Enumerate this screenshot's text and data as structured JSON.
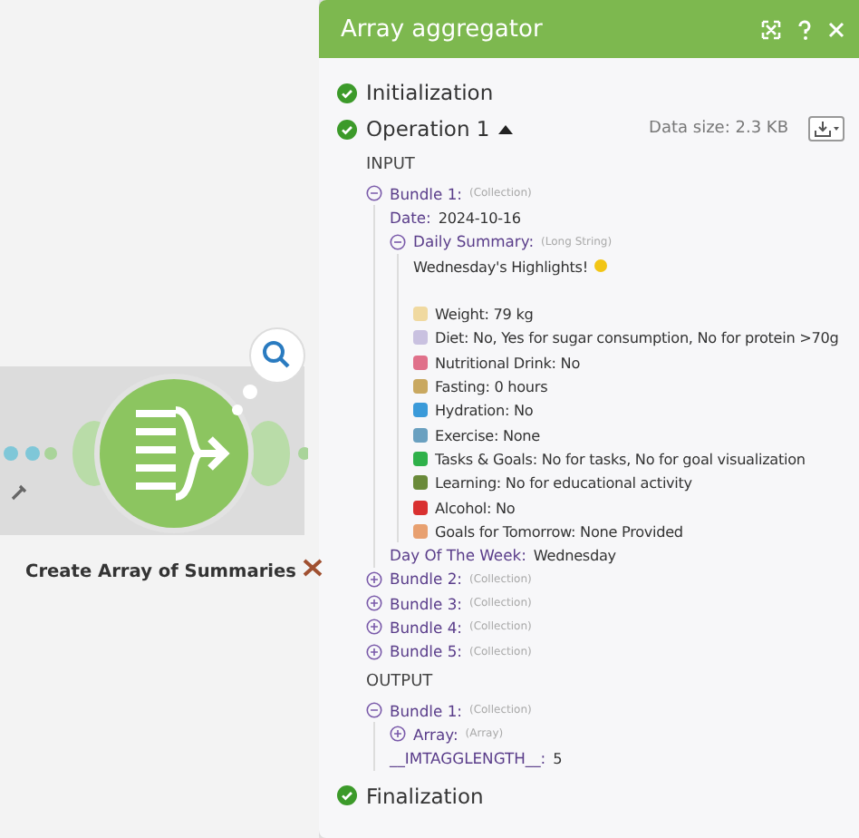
{
  "canvas": {
    "module_label": "Create Array of Summaries"
  },
  "panel": {
    "title": "Array aggregator"
  },
  "initialization": {
    "label": "Initialization"
  },
  "operation": {
    "label": "Operation 1",
    "expanded": true,
    "data_size": "Data size: 2.3 KB",
    "input_label": "INPUT",
    "input": [
      {
        "kind": "collection",
        "label": "Bundle 1:",
        "type": "(Collection)",
        "expanded": true,
        "children": [
          {
            "kind": "field",
            "label": "Date:",
            "value": "2024-10-16"
          },
          {
            "kind": "longtext",
            "label": "Daily Summary:",
            "type": "(Long String)",
            "expanded": true,
            "heading": "Wednesday's Highlights!",
            "lines": [
              "Weight: 79 kg",
              "Diet: No, Yes for sugar consumption, No for protein >70g",
              "Nutritional Drink: No",
              "Fasting: 0 hours",
              "Hydration: No",
              "Exercise: None",
              "Tasks & Goals: No for tasks, No for goal visualization",
              "Learning: No for educational activity",
              "Alcohol: No",
              "Goals for Tomorrow: None Provided"
            ]
          },
          {
            "kind": "field",
            "label": "Day Of The Week:",
            "value": "Wednesday"
          }
        ]
      },
      {
        "kind": "collection",
        "label": "Bundle 2:",
        "type": "(Collection)",
        "expanded": false
      },
      {
        "kind": "collection",
        "label": "Bundle 3:",
        "type": "(Collection)",
        "expanded": false
      },
      {
        "kind": "collection",
        "label": "Bundle 4:",
        "type": "(Collection)",
        "expanded": false
      },
      {
        "kind": "collection",
        "label": "Bundle 5:",
        "type": "(Collection)",
        "expanded": false
      }
    ],
    "output_label": "OUTPUT",
    "output": [
      {
        "kind": "collection",
        "label": "Bundle 1:",
        "type": "(Collection)",
        "expanded": true,
        "children": [
          {
            "kind": "collection",
            "label": "Array:",
            "type": "(Array)",
            "expanded": false
          },
          {
            "kind": "field",
            "label": "__IMTAGGLENGTH__:",
            "value": "5"
          }
        ]
      }
    ]
  },
  "finalization": {
    "label": "Finalization"
  }
}
